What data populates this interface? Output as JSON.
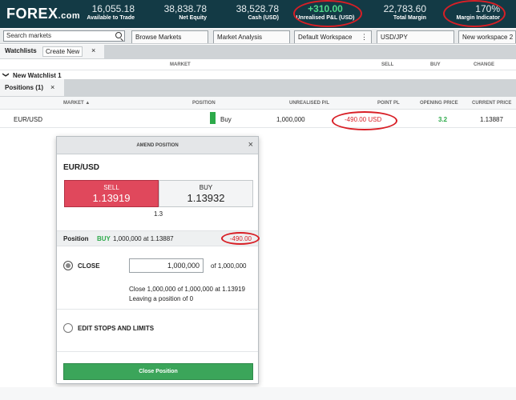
{
  "brand": {
    "logo_main": "FOREX",
    "logo_suffix": ".com"
  },
  "metrics": [
    {
      "value": "16,055.18",
      "label": "Available to Trade"
    },
    {
      "value": "38,838.78",
      "label": "Net Equity"
    },
    {
      "value": "38,528.78",
      "label": "Cash (USD)"
    },
    {
      "value": "+310.00",
      "label": "Unrealised P&L (USD)"
    },
    {
      "value": "22,783.60",
      "label": "Total Margin"
    },
    {
      "value": "170%",
      "label": "Margin Indicator"
    }
  ],
  "toolbar": {
    "search_placeholder": "Search markets",
    "tabs": [
      "Browse Markets",
      "Market Analysis",
      "Default Workspace",
      "USD/JPY",
      "New workspace 2"
    ],
    "kebab": "⋮"
  },
  "watchlists": {
    "title": "Watchlists",
    "create_label": "Create New",
    "close_glyph": "×",
    "columns": [
      "MARKET",
      "SELL",
      "BUY",
      "CHANGE"
    ],
    "group_name": "New Watchlist 1",
    "caret": "❯"
  },
  "positions": {
    "title": "Positions (1)",
    "close_glyph": "×",
    "columns": [
      "MARKET ▲",
      "POSITION",
      "UNREALISED P/L",
      "POINT PL",
      "OPENING PRICE",
      "CURRENT PRICE"
    ],
    "row": {
      "market": "EUR/USD",
      "direction": "Buy",
      "size": "1,000,000",
      "pl": "-490.00  USD",
      "point_pl": "3.2",
      "current_price": "1.13887"
    }
  },
  "dialog": {
    "title": "AMEND POSITION",
    "close_glyph": "×",
    "market": "EUR/USD",
    "sell_label": "SELL",
    "sell_price": "1.13919",
    "buy_label": "BUY",
    "buy_price": "1.13932",
    "spread": "1.3",
    "position_label": "Position",
    "position_dir": "BUY",
    "position_desc": "1,000,000 at 1.13887",
    "position_pl": "-490.00",
    "close_label": "CLOSE",
    "close_qty": "1,000,000",
    "close_of": "of 1,000,000",
    "summary_line1": "Close 1,000,000 of 1,000,000 at 1.13919",
    "summary_line2": "Leaving a position of 0",
    "edit_label": "EDIT STOPS AND LIMITS",
    "submit_label": "Close Position"
  },
  "colors": {
    "topbar": "#133a45",
    "sell": "#e0485c",
    "confirm": "#3ba55a",
    "annotation": "#d81f26",
    "profit": "#2daa4a"
  }
}
